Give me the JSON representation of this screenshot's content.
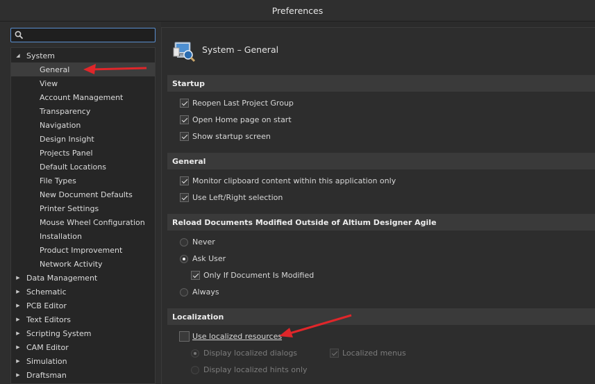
{
  "window": {
    "title": "Preferences"
  },
  "search": {
    "value": "",
    "placeholder": ""
  },
  "tree": {
    "system": {
      "label": "System"
    },
    "system_children": [
      "General",
      "View",
      "Account Management",
      "Transparency",
      "Navigation",
      "Design Insight",
      "Projects Panel",
      "Default Locations",
      "File Types",
      "New Document Defaults",
      "Printer Settings",
      "Mouse Wheel Configuration",
      "Installation",
      "Product Improvement",
      "Network Activity"
    ],
    "selected": "General",
    "collapsed": [
      "Data Management",
      "Schematic",
      "PCB Editor",
      "Text Editors",
      "Scripting System",
      "CAM Editor",
      "Simulation",
      "Draftsman"
    ]
  },
  "page": {
    "title": "System – General",
    "icon": "system-general-icon"
  },
  "startup": {
    "header": "Startup",
    "reopen_last": {
      "label": "Reopen Last Project Group",
      "checked": true
    },
    "open_home": {
      "label": "Open Home page on start",
      "checked": true
    },
    "show_startup": {
      "label": "Show startup screen",
      "checked": true
    }
  },
  "general": {
    "header": "General",
    "monitor_clipboard": {
      "label": "Monitor clipboard content within this application only",
      "checked": true
    },
    "left_right": {
      "label": "Use Left/Right selection",
      "checked": true
    }
  },
  "reload": {
    "header": "Reload Documents Modified Outside of Altium Designer Agile",
    "never": {
      "label": "Never",
      "selected": false
    },
    "ask_user": {
      "label": "Ask User",
      "selected": true
    },
    "only_if_modified": {
      "label": "Only If Document Is Modified",
      "checked": true
    },
    "always": {
      "label": "Always",
      "selected": false
    }
  },
  "localization": {
    "header": "Localization",
    "use_localized": {
      "label": "Use localized resources",
      "checked": false
    },
    "display_dialogs": {
      "label": "Display localized dialogs",
      "selected": true,
      "enabled": false
    },
    "localized_menus": {
      "label": "Localized menus",
      "checked": true,
      "enabled": false
    },
    "display_hints": {
      "label": "Display localized hints only",
      "selected": false,
      "enabled": false
    }
  },
  "colors": {
    "annotation_arrow": "#e0262a",
    "accent": "#5a8fd0"
  }
}
